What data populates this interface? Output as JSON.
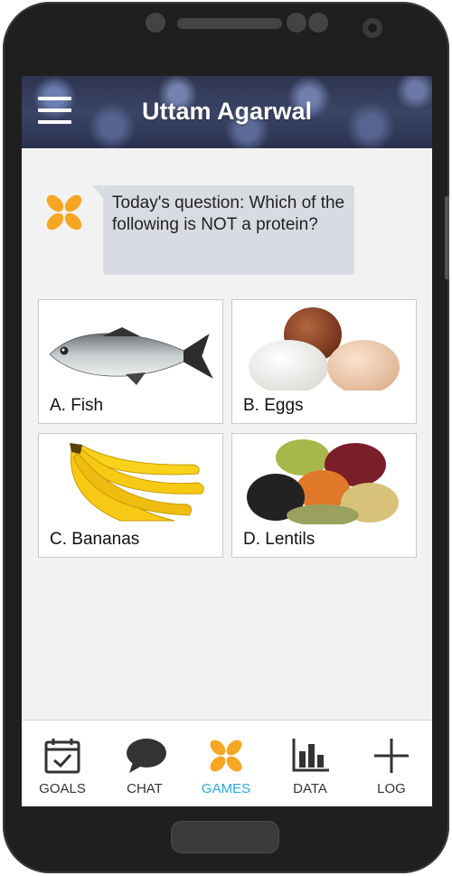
{
  "header": {
    "title": "Uttam Agarwal",
    "menu_icon": "hamburger-menu-icon"
  },
  "chat": {
    "avatar_icon": "flower-logo-icon",
    "question": "Today's question: Which of the following is NOT a protein?"
  },
  "options": [
    {
      "label": "A. Fish",
      "image": "fish-image"
    },
    {
      "label": "B. Eggs",
      "image": "eggs-image"
    },
    {
      "label": "C. Bananas",
      "image": "bananas-image"
    },
    {
      "label": "D. Lentils",
      "image": "lentils-image"
    }
  ],
  "tabs": [
    {
      "label": "GOALS",
      "icon": "calendar-check-icon",
      "active": false
    },
    {
      "label": "CHAT",
      "icon": "chat-bubble-icon",
      "active": false
    },
    {
      "label": "GAMES",
      "icon": "flower-logo-icon",
      "active": true
    },
    {
      "label": "DATA",
      "icon": "bar-chart-icon",
      "active": false
    },
    {
      "label": "LOG",
      "icon": "plus-icon",
      "active": false
    }
  ],
  "colors": {
    "accent": "#29a8df",
    "logo_orange": "#f6a623",
    "bubble_bg": "#d9dbe2"
  }
}
